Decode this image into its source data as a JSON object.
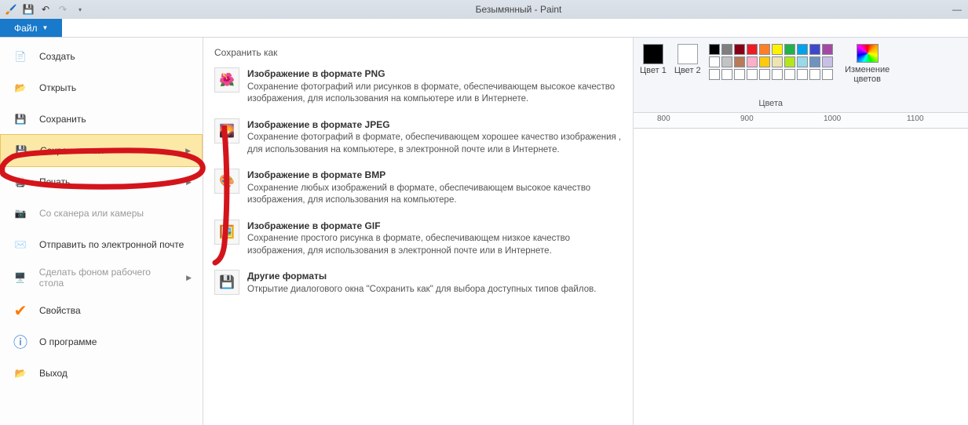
{
  "window": {
    "title": "Безымянный - Paint",
    "minimize": "—"
  },
  "tabs": {
    "file": "Файл"
  },
  "menu": {
    "new": "Создать",
    "open": "Открыть",
    "save": "Сохранить",
    "saveas": "Сохранить как",
    "print": "Печать",
    "scanner": "Со сканера или камеры",
    "email": "Отправить по электронной почте",
    "wallpaper": "Сделать фоном рабочего стола",
    "properties": "Свойства",
    "about": "О программе",
    "exit": "Выход"
  },
  "submenu": {
    "header": "Сохранить как",
    "png": {
      "title": "Изображение в формате PNG",
      "desc": "Сохранение фотографий или рисунков в формате, обеспечивающем высокое качество изображения, для использования на компьютере или в Интернете."
    },
    "jpeg": {
      "title": "Изображение в формате JPEG",
      "desc": "Сохранение фотографий в формате, обеспечивающем хорошее качество изображения , для использования на компьютере, в электронной почте или в Интернете."
    },
    "bmp": {
      "title": "Изображение в формате BMP",
      "desc": "Сохранение любых изображений в формате, обеспечивающем высокое качество изображения, для использования на компьютере."
    },
    "gif": {
      "title": "Изображение в формате GIF",
      "desc": "Сохранение простого рисунка в формате, обеспечивающем низкое качество изображения, для использования в электронной почте или в Интернете."
    },
    "other": {
      "title": "Другие форматы",
      "desc": "Открытие диалогового окна \"Сохранить как\" для выбора доступных типов файлов."
    }
  },
  "ribbon": {
    "color1": "Цвет 1",
    "color2": "Цвет 2",
    "palette_label": "Цвета",
    "edit_colors": "Изменение цветов",
    "color1_hex": "#000000",
    "color2_hex": "#ffffff",
    "swatches_row1": [
      "#000000",
      "#7f7f7f",
      "#880015",
      "#ed1c24",
      "#ff7f27",
      "#fff200",
      "#22b14c",
      "#00a2e8",
      "#3f48cc",
      "#a349a4"
    ],
    "swatches_row2": [
      "#ffffff",
      "#c3c3c3",
      "#b97a57",
      "#ffaec9",
      "#ffc90e",
      "#efe4b0",
      "#b5e61d",
      "#99d9ea",
      "#7092be",
      "#c8bfe7"
    ],
    "swatches_row3": [
      "#ffffff",
      "#ffffff",
      "#ffffff",
      "#ffffff",
      "#ffffff",
      "#ffffff",
      "#ffffff",
      "#ffffff",
      "#ffffff",
      "#ffffff"
    ]
  },
  "ruler": {
    "t800": "800",
    "t900": "900",
    "t1000": "1000",
    "t1100": "1100"
  }
}
